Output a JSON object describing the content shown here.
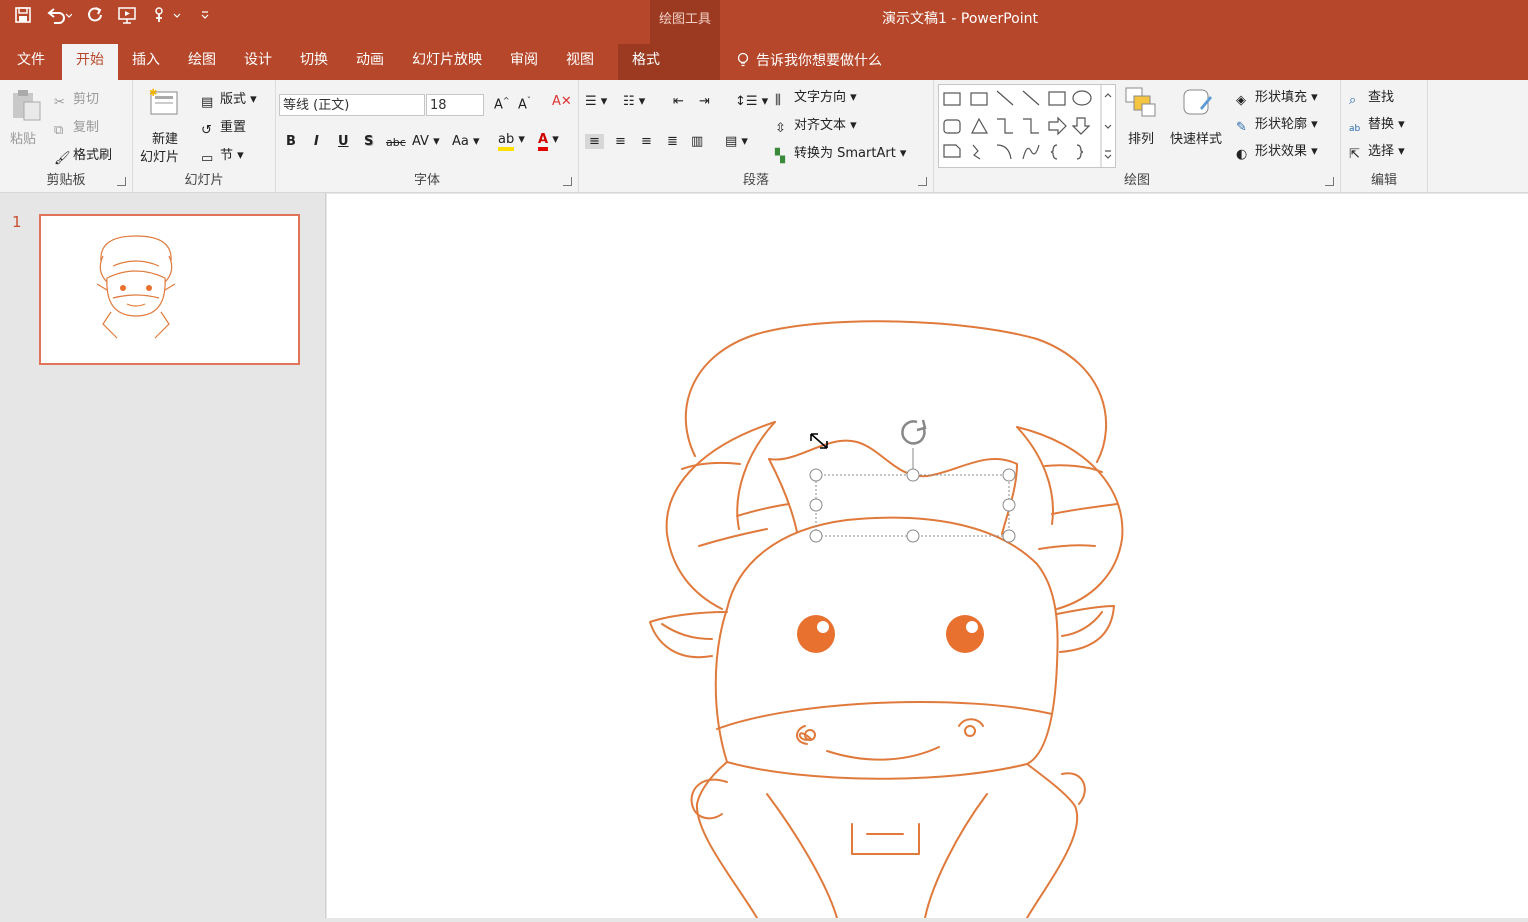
{
  "window": {
    "title": "演示文稿1 - PowerPoint",
    "context_tab_group": "绘图工具"
  },
  "tabs": [
    "文件",
    "开始",
    "插入",
    "绘图",
    "设计",
    "切换",
    "动画",
    "幻灯片放映",
    "审阅",
    "视图",
    "格式"
  ],
  "active_tab": "开始",
  "tell_me": "告诉我你想要做什么",
  "clipboard": {
    "paste": "粘贴",
    "cut": "剪切",
    "copy": "复制",
    "format_painter": "格式刷",
    "label": "剪贴板"
  },
  "slides": {
    "new_slide_line1": "新建",
    "new_slide_line2": "幻灯片",
    "layout": "版式",
    "reset": "重置",
    "section": "节",
    "label": "幻灯片"
  },
  "font": {
    "name": "等线 (正文)",
    "size": "18",
    "bold": "B",
    "italic": "I",
    "underline": "U",
    "shadow": "S",
    "strike": "abc",
    "spacing": "AV",
    "case": "Aa",
    "label": "字体"
  },
  "paragraph": {
    "text_direction": "文字方向",
    "align_text": "对齐文本",
    "smartart": "转换为 SmartArt",
    "label": "段落"
  },
  "drawing": {
    "arrange": "排列",
    "quick_styles": "快速样式",
    "shape_fill": "形状填充",
    "shape_outline": "形状轮廓",
    "shape_effects": "形状效果",
    "label": "绘图"
  },
  "editing": {
    "find": "查找",
    "replace": "替换",
    "select": "选择",
    "label": "编辑"
  },
  "slide_panel": {
    "slide_number": "1"
  },
  "colors": {
    "brand": "#b7472a",
    "accent": "#e07a3c",
    "eye": "#e8712f"
  }
}
